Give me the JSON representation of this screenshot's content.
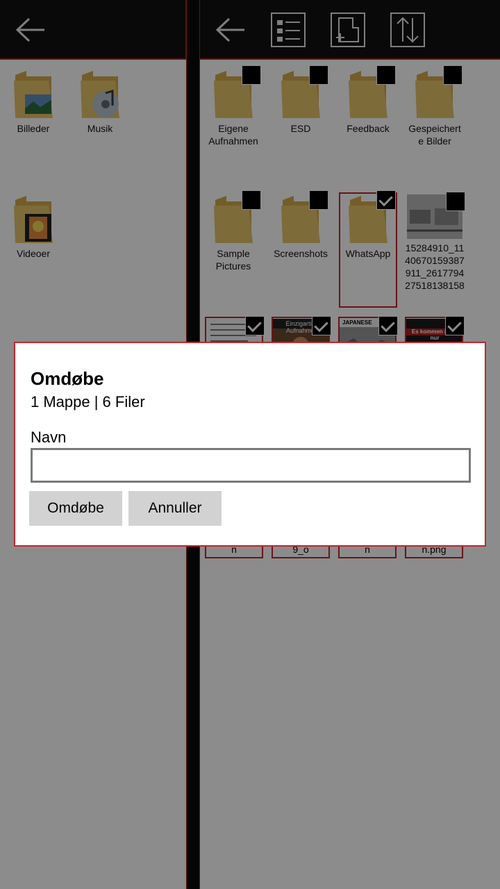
{
  "left_pane": {
    "items": [
      {
        "label": "Billeder"
      },
      {
        "label": "Musik"
      },
      {
        "label": "Videoer"
      }
    ]
  },
  "right_pane": {
    "folders": [
      {
        "label": "Eigene Aufnahmen"
      },
      {
        "label": "ESD"
      },
      {
        "label": "Feedback"
      },
      {
        "label": "Gespeicherte Bilder"
      },
      {
        "label": "Sample Pictures"
      },
      {
        "label": "Screenshots"
      },
      {
        "label": "WhatsApp",
        "checked": true
      }
    ],
    "files": [
      {
        "label": "15284910_1140670159387911_261779427518138158 1_n"
      },
      {
        "label": "Einzigartige Aufnahmen"
      },
      {
        "label": "JAPANESE"
      },
      {
        "label": "Es kommen nicht nur"
      }
    ],
    "partial_labels": [
      "n",
      "9_o",
      "n",
      "n.png"
    ]
  },
  "dialog": {
    "title": "Omdøbe",
    "subtitle": "1 Mappe | 6 Filer",
    "field_label": "Navn",
    "field_value": "",
    "rename_button": "Omdøbe",
    "cancel_button": "Annuller"
  },
  "colors": {
    "accent": "#c0262c",
    "topbar": "#121212",
    "folder": "#e6c36b"
  },
  "icons": {
    "back": "back-arrow-icon",
    "select": "select-list-icon",
    "new_folder": "new-folder-icon",
    "sort": "sort-icon"
  }
}
